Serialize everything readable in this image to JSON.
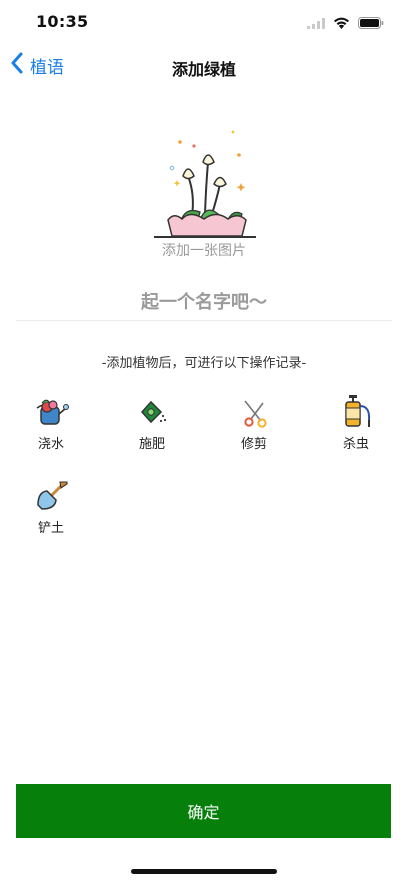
{
  "status_bar": {
    "time": "10:35"
  },
  "nav": {
    "back_label": "植语",
    "title": "添加绿植"
  },
  "photo": {
    "add_label": "添加一张图片"
  },
  "name_input": {
    "placeholder": "起一个名字吧～",
    "value": ""
  },
  "hint": "-添加植物后，可进行以下操作记录-",
  "operations": [
    {
      "label": "浇水",
      "icon": "watering-can-icon"
    },
    {
      "label": "施肥",
      "icon": "fertilizer-bag-icon"
    },
    {
      "label": "修剪",
      "icon": "scissors-icon"
    },
    {
      "label": "杀虫",
      "icon": "sprayer-icon"
    },
    {
      "label": "铲土",
      "icon": "shovel-icon"
    }
  ],
  "confirm_label": "确定",
  "colors": {
    "accent": "#06800b",
    "link": "#1a7fe6",
    "placeholder": "#9a9a9a"
  }
}
